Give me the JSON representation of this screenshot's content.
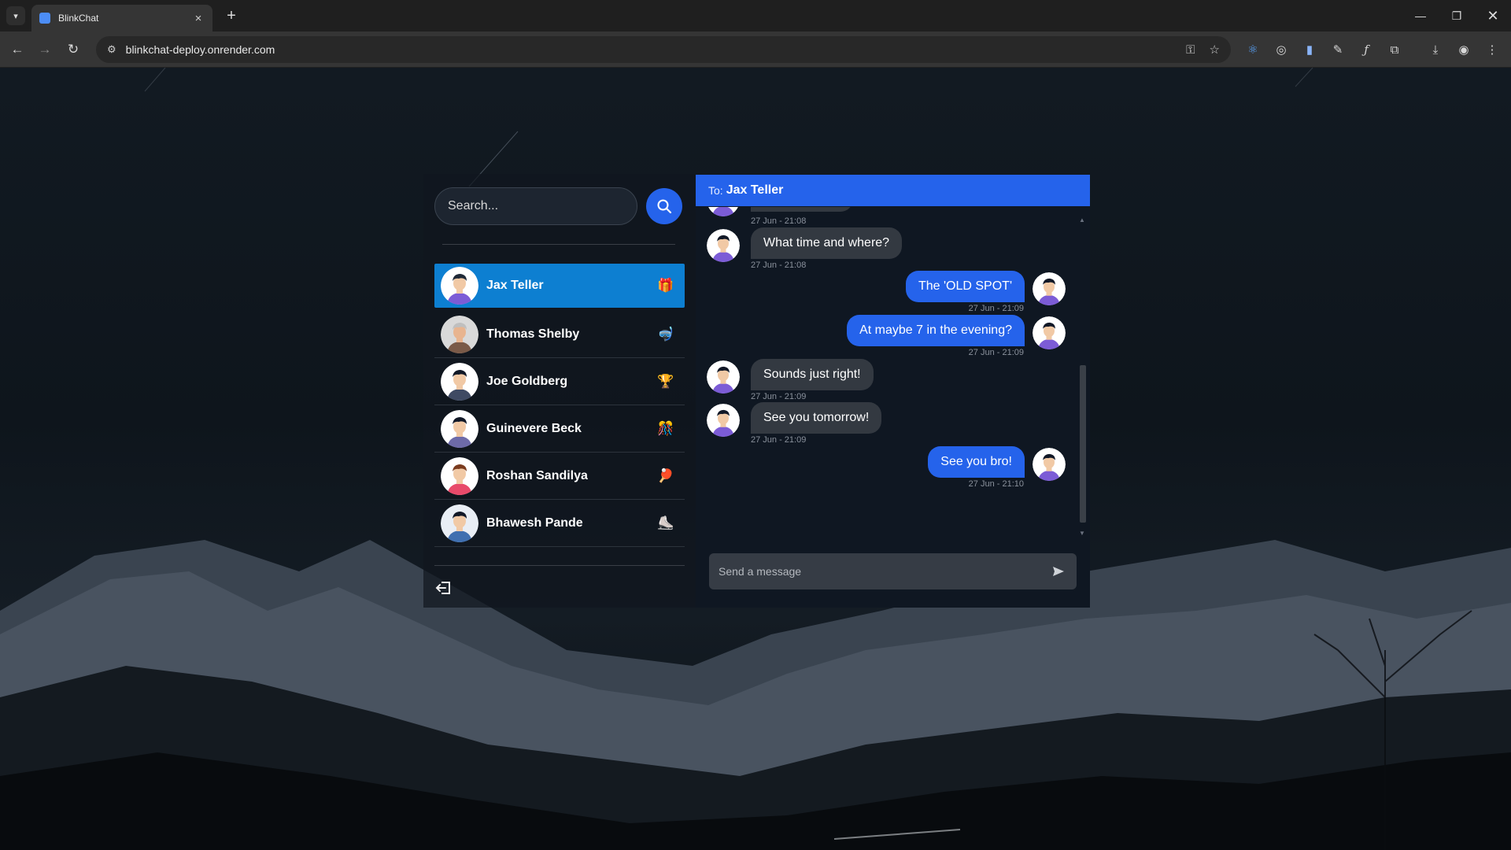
{
  "browser": {
    "tab_title": "BlinkChat",
    "url": "blinkchat-deploy.onrender.com"
  },
  "search": {
    "placeholder": "Search..."
  },
  "contacts": [
    {
      "name": "Jax Teller",
      "emoji": "🎁",
      "active": true
    },
    {
      "name": "Thomas Shelby",
      "emoji": "🤿",
      "active": false
    },
    {
      "name": "Joe Goldberg",
      "emoji": "🏆",
      "active": false
    },
    {
      "name": "Guinevere Beck",
      "emoji": "🎊",
      "active": false
    },
    {
      "name": "Roshan Sandilya",
      "emoji": "🏓",
      "active": false
    },
    {
      "name": "Bhawesh Pande",
      "emoji": "⛸️",
      "active": false
    }
  ],
  "chat": {
    "to_label": "To:",
    "recipient": "Jax Teller",
    "top_partial_stamp": "27 Jun - 21:08",
    "messages": [
      {
        "from": "them",
        "text": "What time and where?",
        "stamp": "27 Jun - 21:08"
      },
      {
        "from": "me",
        "text": "The 'OLD SPOT'",
        "stamp": "27 Jun - 21:09"
      },
      {
        "from": "me",
        "text": "At maybe 7 in the evening?",
        "stamp": "27 Jun - 21:09"
      },
      {
        "from": "them",
        "text": "Sounds just right!",
        "stamp": "27 Jun - 21:09"
      },
      {
        "from": "them",
        "text": "See you tomorrow!",
        "stamp": "27 Jun - 21:09"
      },
      {
        "from": "me",
        "text": "See you bro!",
        "stamp": "27 Jun - 21:10"
      }
    ],
    "composer_placeholder": "Send a message"
  },
  "colors": {
    "accent": "#2563eb",
    "active_contact": "#0d7fd1",
    "incoming_bubble": "#333941"
  }
}
